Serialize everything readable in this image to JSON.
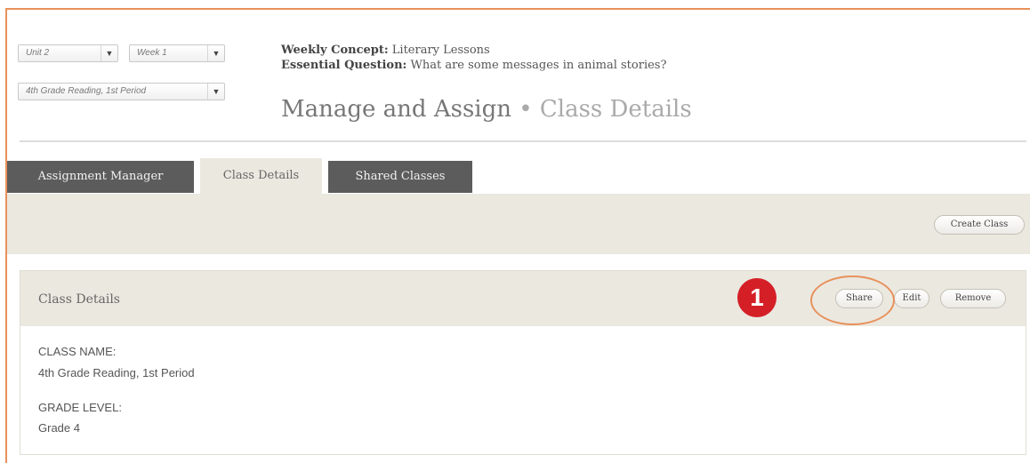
{
  "filters": {
    "unit": "Unit 2",
    "week": "Week 1",
    "class": "4th Grade Reading, 1st Period",
    "arrow_glyph": "▼"
  },
  "header": {
    "concept_label": "Weekly Concept:",
    "concept_value": "Literary Lessons",
    "question_label": "Essential Question:",
    "question_value": "What are some messages in animal stories?",
    "title_main": "Manage and Assign",
    "title_sep": " • ",
    "title_sub": "Class Details"
  },
  "tabs": [
    {
      "label": "Assignment Manager",
      "active": false
    },
    {
      "label": "Class Details",
      "active": true
    },
    {
      "label": "Shared Classes",
      "active": false
    }
  ],
  "toolbar": {
    "create_class_label": "Create Class"
  },
  "panel": {
    "title": "Class Details",
    "share_label": "Share",
    "edit_label": "Edit",
    "remove_label": "Remove",
    "fields": [
      {
        "label": "CLASS NAME:",
        "value": "4th Grade Reading, 1st Period"
      },
      {
        "label": "GRADE LEVEL:",
        "value": "Grade 4"
      }
    ]
  },
  "annotation": {
    "step": "1"
  },
  "colors": {
    "accent": "#e8915b",
    "badge": "#d51f27",
    "tab_dark": "#5c5c5c",
    "toolbar_bg": "#ebe8e0"
  }
}
